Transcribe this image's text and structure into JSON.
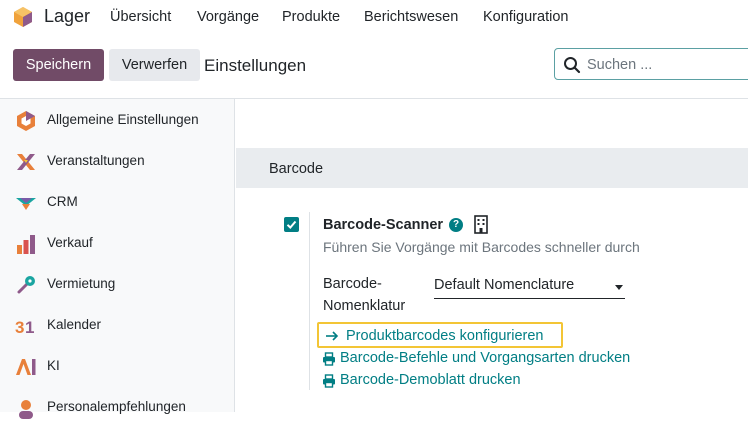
{
  "navbar": {
    "app_name": "Lager",
    "menu": [
      "Übersicht",
      "Vorgänge",
      "Produkte",
      "Berichtswesen",
      "Konfiguration"
    ]
  },
  "control_panel": {
    "save_label": "Speichern",
    "discard_label": "Verwerfen",
    "title": "Einstellungen",
    "search_placeholder": "Suchen ..."
  },
  "sidebar": {
    "items": [
      {
        "label": "Allgemeine Einstellungen",
        "icon": "settings-hexagon-icon"
      },
      {
        "label": "Veranstaltungen",
        "icon": "events-icon"
      },
      {
        "label": "CRM",
        "icon": "crm-icon"
      },
      {
        "label": "Verkauf",
        "icon": "sales-chart-icon"
      },
      {
        "label": "Vermietung",
        "icon": "rental-key-icon"
      },
      {
        "label": "Kalender",
        "icon": "calendar-icon"
      },
      {
        "label": "KI",
        "icon": "ai-icon"
      },
      {
        "label": "Personalempfehlungen",
        "icon": "referral-icon"
      }
    ]
  },
  "main": {
    "section_title": "Barcode",
    "setting": {
      "title": "Barcode-Scanner",
      "help": "?",
      "description": "Führen Sie Vorgänge mit Barcodes schneller durch",
      "checked": true,
      "field_label_line1": "Barcode-",
      "field_label_line2": "Nomenklatur",
      "nomenclature_value": "Default Nomenclature",
      "links": {
        "configure": "Produktbarcodes konfigurieren",
        "print_commands": "Barcode-Befehle und Vorgangsarten drucken",
        "print_demo": "Barcode-Demoblatt drucken"
      }
    }
  },
  "colors": {
    "primary": "#714b67",
    "accent": "#017e84",
    "highlight": "#f3c535"
  }
}
